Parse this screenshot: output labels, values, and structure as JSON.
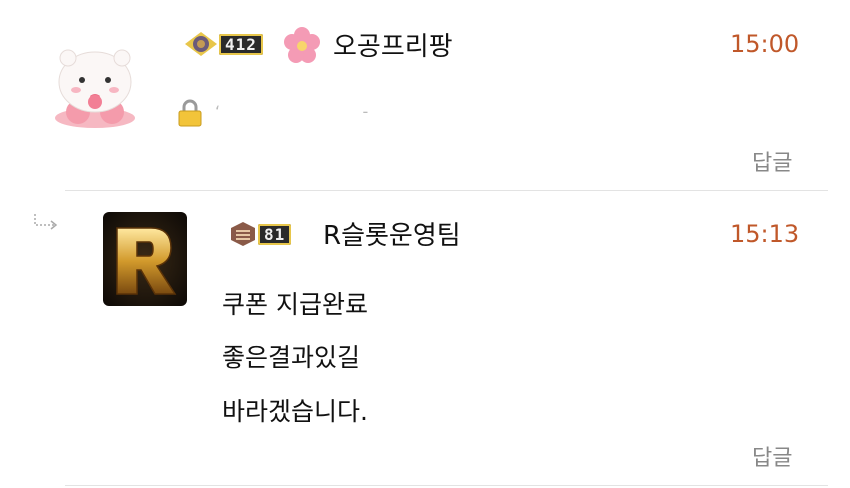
{
  "comments": [
    {
      "level": "412",
      "nickname": "오공프리팡",
      "time": "15:00",
      "secret_icon": "lock-icon",
      "reply_label": "답글"
    },
    {
      "level": "81",
      "nickname": "R슬롯운영팀",
      "time": "15:13",
      "body_lines": [
        "쿠폰 지급완료",
        "좋은결과있길",
        "바라겠습니다."
      ],
      "reply_label": "답글"
    }
  ],
  "colors": {
    "time": "#c0582a",
    "reply": "#888888",
    "divider": "#e3e3e3"
  }
}
